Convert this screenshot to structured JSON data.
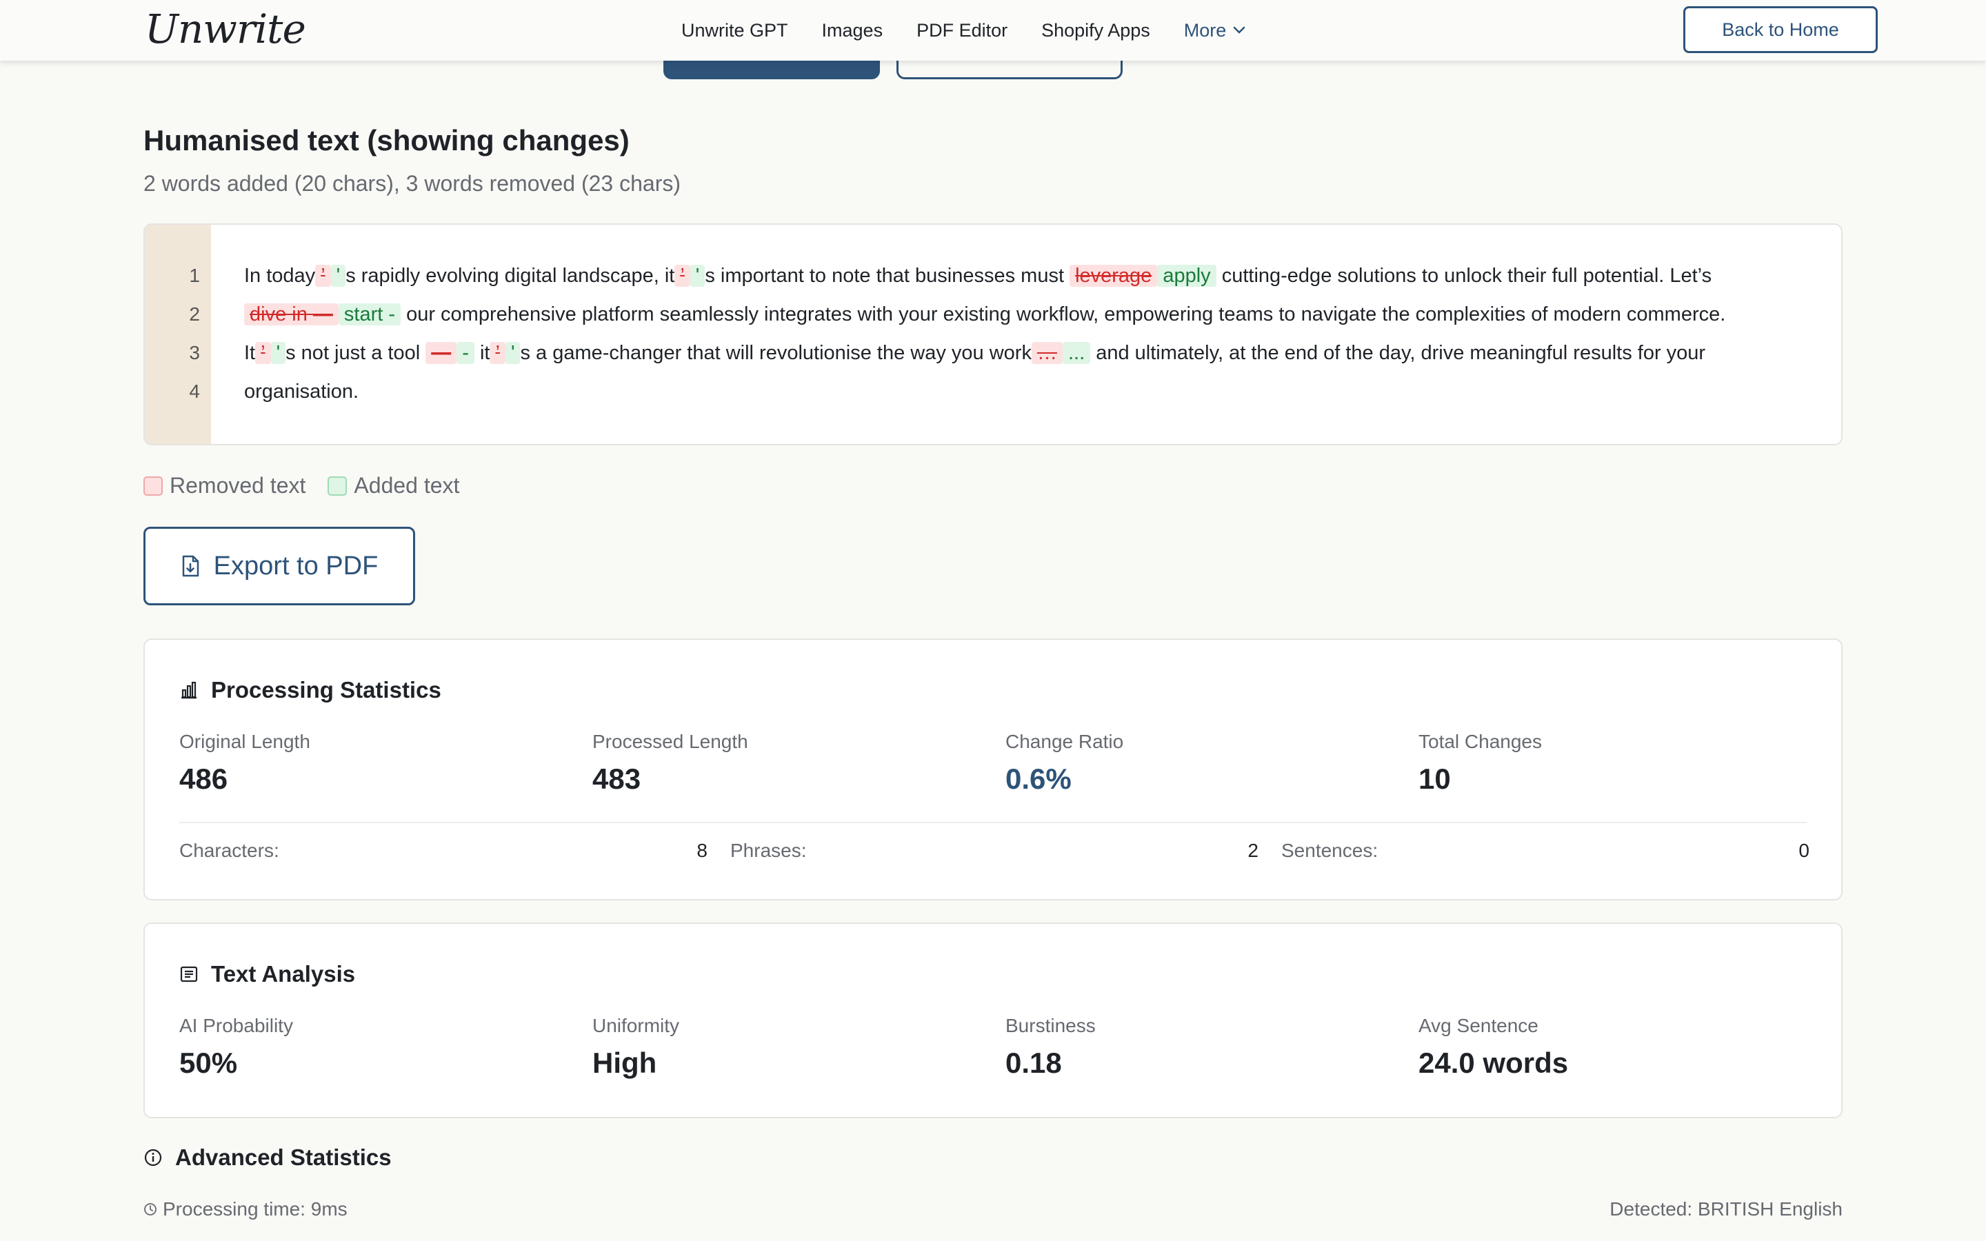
{
  "header": {
    "logo": "Unwrite",
    "nav": [
      "Unwrite GPT",
      "Images",
      "PDF Editor",
      "Shopify Apps"
    ],
    "more_label": "More",
    "back_label": "Back to Home"
  },
  "result": {
    "title": "Humanised text (showing changes)",
    "summary": "2 words added (20 chars), 3 words removed (23 chars)"
  },
  "diff": {
    "line_numbers": [
      "1",
      "2",
      "3",
      "4"
    ],
    "line1": {
      "t1": "In today",
      "d1": "’",
      "a1": "'",
      "t2": "s rapidly evolving digital landscape, it",
      "d2": "’",
      "a2": "'",
      "t3": "s important to note that businesses must",
      "d3": "leverage",
      "a3": "apply",
      "t4": "cutting-edge solutions to unlock their full potential. Let’s"
    },
    "line2": {
      "d1": "dive in —",
      "a1": "start -",
      "t1": "our comprehensive platform seamlessly integrates with your existing workflow, empowering teams to navigate the complexities of modern commerce."
    },
    "line3": {
      "t1": "It",
      "d1": "’",
      "a1": "'",
      "t2": "s not just a tool",
      "d2": "—",
      "a2": "-",
      "t3": "it",
      "d3": "’",
      "a3": "'",
      "t4": "s a game-changer that will revolutionise the way you work",
      "d4": "…",
      "a4": "...",
      "t5": "and ultimately, at the end of the day, drive meaningful results for your"
    },
    "line4": {
      "t1": "organisation."
    }
  },
  "legend": {
    "removed": "Removed text",
    "added": "Added text"
  },
  "export_label": "Export to PDF",
  "processing": {
    "title": "Processing Statistics",
    "stats": [
      {
        "label": "Original Length",
        "value": "486"
      },
      {
        "label": "Processed Length",
        "value": "483"
      },
      {
        "label": "Change Ratio",
        "value": "0.6%"
      },
      {
        "label": "Total Changes",
        "value": "10"
      }
    ],
    "breakdown": [
      {
        "label": "Characters:",
        "value": "8"
      },
      {
        "label": "Phrases:",
        "value": "2"
      },
      {
        "label": "Sentences:",
        "value": "0"
      }
    ]
  },
  "analysis": {
    "title": "Text Analysis",
    "stats": [
      {
        "label": "AI Probability",
        "value": "50%"
      },
      {
        "label": "Uniformity",
        "value": "High"
      },
      {
        "label": "Burstiness",
        "value": "0.18"
      },
      {
        "label": "Avg Sentence",
        "value": "24.0 words"
      }
    ]
  },
  "advanced": {
    "title": "Advanced Statistics",
    "processing_time": "Processing time: 9ms",
    "detected": "Detected: BRITISH English"
  },
  "colors": {
    "accent": "#2d5379",
    "removed_bg": "#fde1e1",
    "added_bg": "#dff5e6",
    "gutter": "#f1e7d9"
  },
  "icons": {
    "export": "file-download-icon",
    "processing": "bar-chart-icon",
    "analysis": "document-lines-icon",
    "advanced": "info-circle-icon",
    "time": "clock-icon",
    "more": "chevron-down-icon"
  }
}
